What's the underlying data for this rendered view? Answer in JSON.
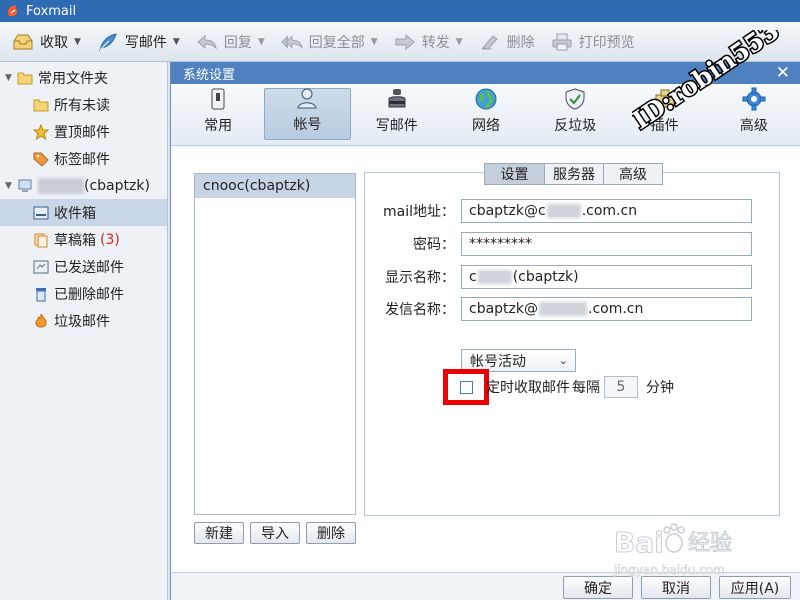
{
  "app": {
    "title": "Foxmail"
  },
  "toolbar": {
    "receive": "收取",
    "compose": "写邮件",
    "reply": "回复",
    "reply_all": "回复全部",
    "forward": "转发",
    "delete": "删除",
    "print_preview": "打印预览"
  },
  "sidebar": {
    "common_folders": "常用文件夹",
    "all_unread": "所有未读",
    "pinned": "置顶邮件",
    "tagged": "标签邮件",
    "account_suffix": "(cbaptzk)",
    "inbox": "收件箱",
    "drafts": "草稿箱",
    "drafts_count": "(3)",
    "sent": "已发送邮件",
    "deleted": "已删除邮件",
    "junk": "垃圾邮件"
  },
  "dialog": {
    "title": "系统设置",
    "tabs": [
      "常用",
      "帐号",
      "写邮件",
      "网络",
      "反垃圾",
      "插件",
      "高级"
    ],
    "account_list": [
      "cnooc(cbaptzk)"
    ],
    "buttons": {
      "new": "新建",
      "import": "导入",
      "delete": "删除"
    },
    "subtabs": [
      "设置",
      "服务器",
      "高级"
    ],
    "form": {
      "email_label": "mail地址：",
      "email_prefix": "cbaptzk@c",
      "email_suffix": ".com.cn",
      "password_label": "密码：",
      "password_value": "*********",
      "display_name_label": "显示名称：",
      "display_name_prefix": "c",
      "display_name_suffix": "(cbaptzk)",
      "sender_name_label": "发信名称：",
      "sender_prefix": "cbaptzk@",
      "sender_suffix": ".com.cn",
      "account_status": "帐号活动",
      "timer_label": "定时收取邮件",
      "every_label": "每隔",
      "interval_value": "5",
      "minute_label": "分钟"
    },
    "footer": {
      "ok": "确定",
      "cancel": "取消",
      "apply": "应用(A)"
    }
  },
  "watermarks": {
    "user": "ID:robin553",
    "baidu": "Bai",
    "baidu_cn": "经验",
    "baidu_url": "jingyan.baidu.com"
  },
  "colors": {
    "titlebar": "#2f6bb3",
    "dialog_title": "#4f80bf",
    "highlight_box": "#ee0000",
    "draft_count": "#e02020"
  }
}
